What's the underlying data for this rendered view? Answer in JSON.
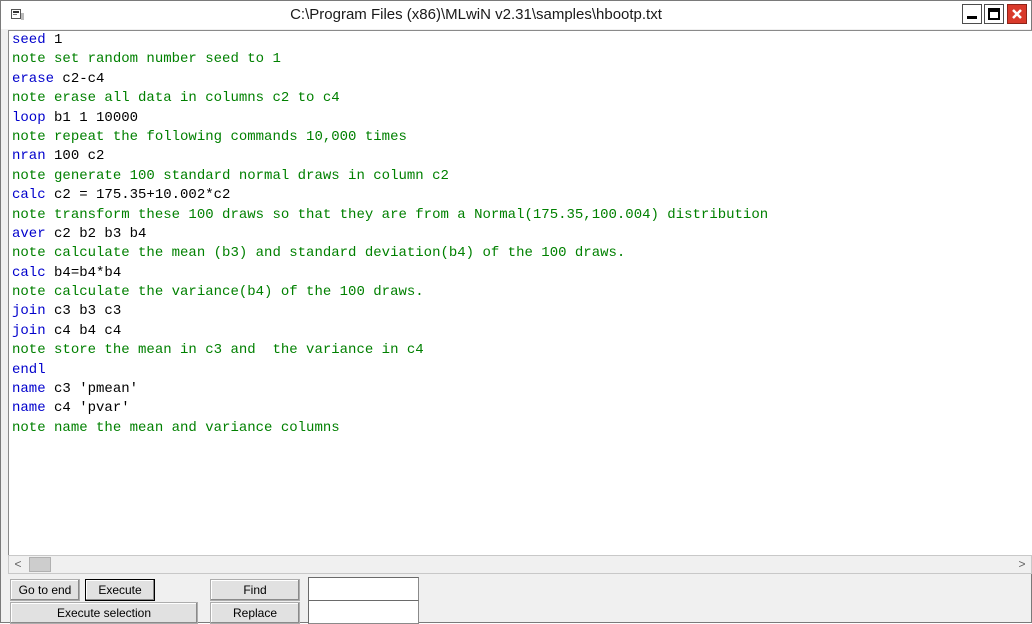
{
  "window": {
    "title": "C:\\Program Files (x86)\\MLwiN v2.31\\samples\\hbootp.txt"
  },
  "editor": {
    "lines": [
      {
        "cmd": "seed",
        "args": " 1",
        "note": false
      },
      {
        "cmd": "note",
        "args": " set random number seed to 1",
        "note": true
      },
      {
        "cmd": "erase",
        "args": " c2-c4",
        "note": false
      },
      {
        "cmd": "note",
        "args": " erase all data in columns c2 to c4",
        "note": true
      },
      {
        "cmd": "loop",
        "args": " b1 1 10000",
        "note": false
      },
      {
        "cmd": "note",
        "args": " repeat the following commands 10,000 times",
        "note": true
      },
      {
        "cmd": "nran",
        "args": " 100 c2",
        "note": false
      },
      {
        "cmd": "note",
        "args": " generate 100 standard normal draws in column c2",
        "note": true
      },
      {
        "cmd": "calc",
        "args": " c2 = 175.35+10.002*c2",
        "note": false
      },
      {
        "cmd": "note",
        "args": " transform these 100 draws so that they are from a Normal(175.35,100.004) distribution",
        "note": true
      },
      {
        "cmd": "aver",
        "args": " c2 b2 b3 b4",
        "note": false
      },
      {
        "cmd": "note",
        "args": " calculate the mean (b3) and standard deviation(b4) of the 100 draws.",
        "note": true
      },
      {
        "cmd": "calc",
        "args": " b4=b4*b4",
        "note": false
      },
      {
        "cmd": "note",
        "args": " calculate the variance(b4) of the 100 draws.",
        "note": true
      },
      {
        "cmd": "join",
        "args": " c3 b3 c3",
        "note": false
      },
      {
        "cmd": "join",
        "args": " c4 b4 c4",
        "note": false
      },
      {
        "cmd": "note",
        "args": " store the mean in c3 and  the variance in c4",
        "note": true
      },
      {
        "cmd": "endl",
        "args": "",
        "note": false
      },
      {
        "cmd": "name",
        "args": " c3 'pmean'",
        "note": false
      },
      {
        "cmd": "name",
        "args": " c4 'pvar'",
        "note": false
      },
      {
        "cmd": "note",
        "args": " name the mean and variance columns",
        "note": true
      }
    ]
  },
  "scrollbar": {
    "left_arrow": "<",
    "right_arrow": ">"
  },
  "toolbar": {
    "go_to_end": "Go to end",
    "execute": "Execute",
    "find": "Find",
    "execute_selection": "Execute selection",
    "replace": "Replace",
    "find_value": "",
    "replace_value": ""
  },
  "colors": {
    "command": "#0000cc",
    "note": "#008000",
    "close_button": "#d93a2b"
  }
}
